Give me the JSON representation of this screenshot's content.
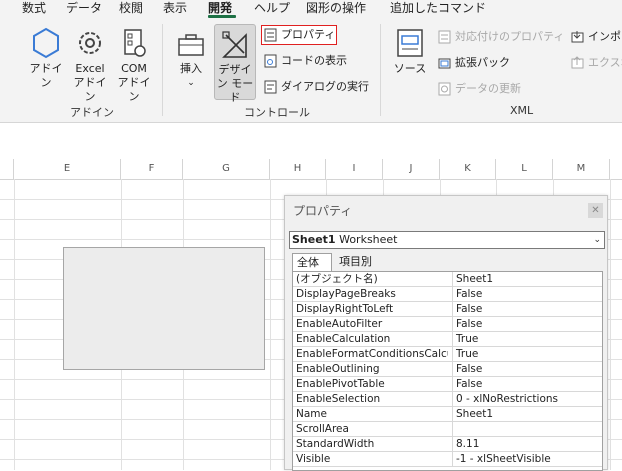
{
  "ribbon_tabs": [
    "数式",
    "データ",
    "校閲",
    "表示",
    "開発",
    "ヘルプ",
    "図形の操作",
    "追加したコマンド"
  ],
  "accent": "#1e7145",
  "addins_group": {
    "label": "アドイン",
    "addins": "アドイン",
    "excel_addins": "Excel アドイン",
    "com_addins": "COM アドイン"
  },
  "controls_group": {
    "label": "コントロール",
    "insert": "挿入",
    "design_mode": "デザイン モード",
    "properties": "プロパティ",
    "view_code": "コードの表示",
    "run_dialog": "ダイアログの実行"
  },
  "xml_group": {
    "label": "XML",
    "source": "ソース",
    "map_properties": "対応付けのプロパティ",
    "expansion_packs": "拡張パック",
    "refresh_data": "データの更新",
    "import": "インポー",
    "export": "エクスポ"
  },
  "columns": [
    "E",
    "F",
    "G",
    "H",
    "I",
    "J",
    "K",
    "L",
    "M"
  ],
  "properties_window": {
    "title": "プロパティ",
    "object_name": "Sheet1",
    "object_type": "Worksheet",
    "tab_all": "全体",
    "tab_category": "項目別",
    "rows": [
      {
        "name": "(オブジェクト名)",
        "value": "Sheet1"
      },
      {
        "name": "DisplayPageBreaks",
        "value": "False"
      },
      {
        "name": "DisplayRightToLeft",
        "value": "False"
      },
      {
        "name": "EnableAutoFilter",
        "value": "False"
      },
      {
        "name": "EnableCalculation",
        "value": "True"
      },
      {
        "name": "EnableFormatConditionsCalcu",
        "value": "True"
      },
      {
        "name": "EnableOutlining",
        "value": "False"
      },
      {
        "name": "EnablePivotTable",
        "value": "False"
      },
      {
        "name": "EnableSelection",
        "value": "0 - xlNoRestrictions"
      },
      {
        "name": "Name",
        "value": "Sheet1"
      },
      {
        "name": "ScrollArea",
        "value": ""
      },
      {
        "name": "StandardWidth",
        "value": "8.11"
      },
      {
        "name": "Visible",
        "value": "-1 - xlSheetVisible"
      }
    ]
  }
}
